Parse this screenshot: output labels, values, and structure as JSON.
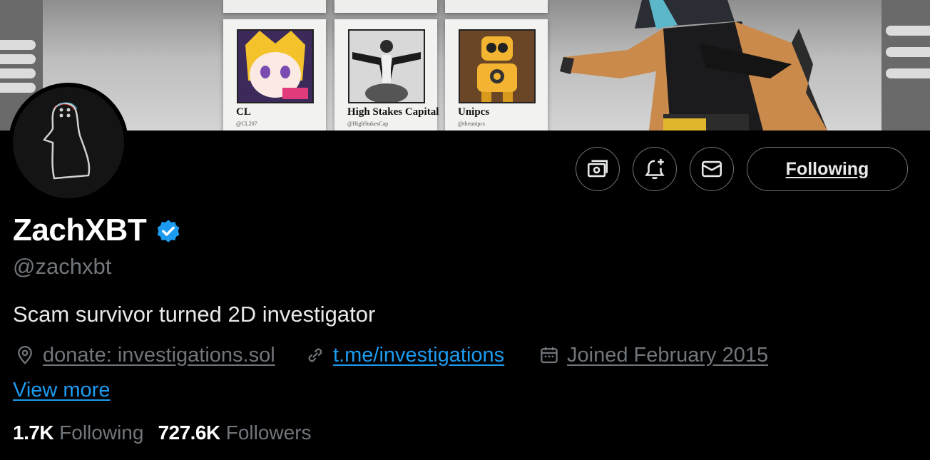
{
  "banner": {
    "cards": [
      {
        "name": "CL",
        "handle": "@CL207"
      },
      {
        "name": "High Stakes Capital",
        "handle": "@HighStakesCap"
      },
      {
        "name": "Unipcs",
        "handle": "@theunipcs"
      }
    ]
  },
  "profile": {
    "name": "ZachXBT",
    "handle": "@zachxbt",
    "bio": "Scam survivor turned 2D investigator",
    "location": "donate: investigations.sol",
    "website": "t.me/investigations",
    "joined": "Joined February 2015",
    "view_more": "View more",
    "following_count": "1.7K",
    "following_label": "Following",
    "followers_count": "727.6K",
    "followers_label": "Followers",
    "verified_color": "#1d9bf0"
  },
  "actions": {
    "follow_state_label": "Following",
    "icons": [
      "money-icon",
      "notification-add-icon",
      "message-icon"
    ]
  },
  "colors": {
    "background": "#000000",
    "text_primary": "#e7e9ea",
    "text_secondary": "#71767b",
    "link": "#1d9bf0"
  }
}
